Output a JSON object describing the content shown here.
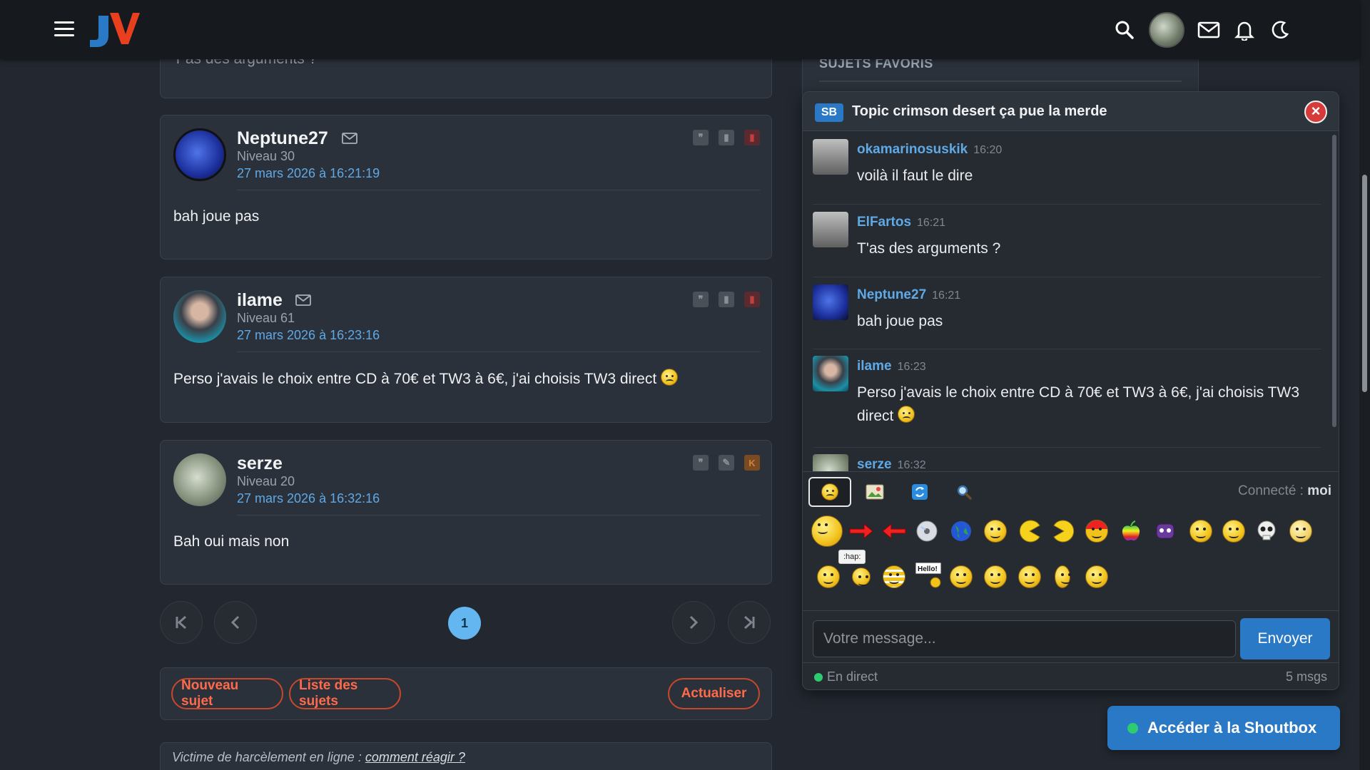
{
  "topbar": {
    "logo_text": "JV",
    "avatar_alt": "avatar"
  },
  "posts": [
    {
      "content": "T'as des arguments ?"
    },
    {
      "pseudo": "Neptune27",
      "niveau": "Niveau 30",
      "date": "27 mars 2026 à 16:21:19",
      "content": "bah joue pas"
    },
    {
      "pseudo": "ilame",
      "niveau": "Niveau 61",
      "date": "27 mars 2026 à 16:23:16",
      "content": "Perso j'avais le choix entre CD à 70€ et TW3 à 6€, j'ai choisis TW3 direct"
    },
    {
      "pseudo": "serze",
      "niveau": "Niveau 20",
      "date": "27 mars 2026 à 16:32:16",
      "content": "Bah oui mais non"
    }
  ],
  "pagination": {
    "current": "1"
  },
  "buttons": {
    "new_topic": "Nouveau sujet",
    "topic_list": "Liste des sujets",
    "refresh": "Actualiser"
  },
  "warning": {
    "text": "Victime de harcèlement en ligne : ",
    "link": "comment réagir ?"
  },
  "favorites": {
    "title": "SUJETS FAVORIS"
  },
  "shoutbox": {
    "badge": "SB",
    "title": "Topic crimson desert ça pue la merde",
    "close": "×",
    "messages": [
      {
        "user": "okamarinosuskik",
        "time": "16:20",
        "text": "voilà il faut le dire"
      },
      {
        "user": "ElFartos",
        "time": "16:21",
        "text": "T'as des arguments ?"
      },
      {
        "user": "Neptune27",
        "time": "16:21",
        "text": "bah joue pas"
      },
      {
        "user": "ilame",
        "time": "16:23",
        "text": "Perso j'avais le choix entre CD à 70€ et TW3 à 6€, j'ai choisis TW3 direct"
      },
      {
        "user": "serze",
        "time": "16:32",
        "text": ""
      }
    ],
    "connected_label": "Connecté : ",
    "connected_user": "moi",
    "tooltip": ":hap:",
    "input_placeholder": "Votre message...",
    "send": "Envoyer",
    "status": "En direct",
    "count": "5 msgs"
  },
  "open_shoutbox": "Accéder à la Shoutbox",
  "colors": {
    "accent_blue": "#2a79c6",
    "link_blue": "#5fa9e6",
    "orange": "#ff6a4a",
    "live_green": "#2ecc71"
  }
}
